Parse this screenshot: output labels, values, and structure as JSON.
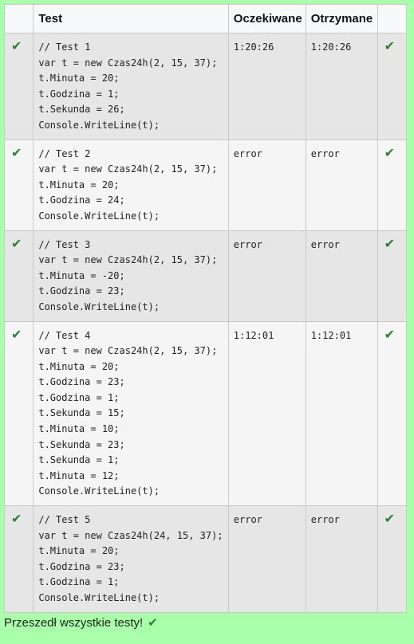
{
  "headers": {
    "status": "",
    "test": "Test",
    "expected": "Oczekiwane",
    "got": "Otrzymane",
    "status2": ""
  },
  "rows": [
    {
      "code": "// Test 1\nvar t = new Czas24h(2, 15, 37);\nt.Minuta = 20;\nt.Godzina = 1;\nt.Sekunda = 26;\nConsole.WriteLine(t);",
      "expected": "1:20:26",
      "got": "1:20:26",
      "passed_icon": "check-icon"
    },
    {
      "code": "// Test 2\nvar t = new Czas24h(2, 15, 37);\nt.Minuta = 20;\nt.Godzina = 24;\nConsole.WriteLine(t);",
      "expected": "error",
      "got": "error",
      "passed_icon": "check-icon"
    },
    {
      "code": "// Test 3\nvar t = new Czas24h(2, 15, 37);\nt.Minuta = -20;\nt.Godzina = 23;\nConsole.WriteLine(t);",
      "expected": "error",
      "got": "error",
      "passed_icon": "check-icon"
    },
    {
      "code": "// Test 4\nvar t = new Czas24h(2, 15, 37);\nt.Minuta = 20;\nt.Godzina = 23;\nt.Godzina = 1;\nt.Sekunda = 15;\nt.Minuta = 10;\nt.Sekunda = 23;\nt.Sekunda = 1;\nt.Minuta = 12;\nConsole.WriteLine(t);",
      "expected": "1:12:01",
      "got": "1:12:01",
      "passed_icon": "check-icon"
    },
    {
      "code": "// Test 5\nvar t = new Czas24h(24, 15, 37);\nt.Minuta = 20;\nt.Godzina = 23;\nt.Godzina = 1;\nConsole.WriteLine(t);",
      "expected": "error",
      "got": "error",
      "passed_icon": "check-icon"
    }
  ],
  "summary": {
    "text": "Przeszedł wszystkie testy!",
    "icon": "check-icon"
  },
  "colors": {
    "background": "#aaffaa",
    "check": "#2e7d32"
  }
}
